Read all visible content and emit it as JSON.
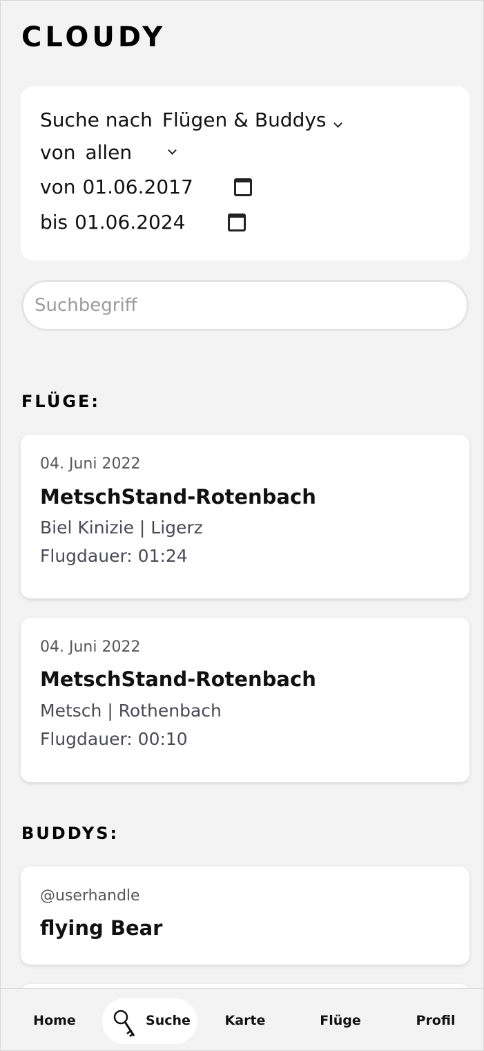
{
  "app": {
    "title": "CLOUDY"
  },
  "filters": {
    "search_for_label": "Suche nach",
    "search_for_value": "Flügen & Buddys",
    "from_label": "von",
    "from_value": "allen",
    "date_from_label": "von",
    "date_from_value": "01.06.2017",
    "date_to_label": "bis",
    "date_to_value": "01.06.2024"
  },
  "search": {
    "placeholder": "Suchbegriff",
    "value": ""
  },
  "flights_section": {
    "heading": "FLÜGE:",
    "items": [
      {
        "date": "04. Juni 2022",
        "title": "MetschStand-Rotenbach",
        "route": "Biel Kinizie | Ligerz",
        "duration": "Flugdauer: 01:24"
      },
      {
        "date": "04. Juni 2022",
        "title": "MetschStand-Rotenbach",
        "route": "Metsch | Rothenbach",
        "duration": "Flugdauer: 00:10"
      }
    ]
  },
  "buddies_section": {
    "heading": "BUDDYS:",
    "items": [
      {
        "handle": "@userhandle",
        "name": "flying Bear"
      }
    ]
  },
  "nav": {
    "items": [
      {
        "label": "Home",
        "icon": ""
      },
      {
        "label": "Suche",
        "icon": "key-icon",
        "active": true
      },
      {
        "label": "Karte",
        "icon": ""
      },
      {
        "label": "Flüge",
        "icon": ""
      },
      {
        "label": "Profil",
        "icon": ""
      }
    ]
  },
  "colors": {
    "background": "#f3f3f3",
    "card": "#ffffff",
    "text": "#111111",
    "muted": "#4a4a55"
  }
}
